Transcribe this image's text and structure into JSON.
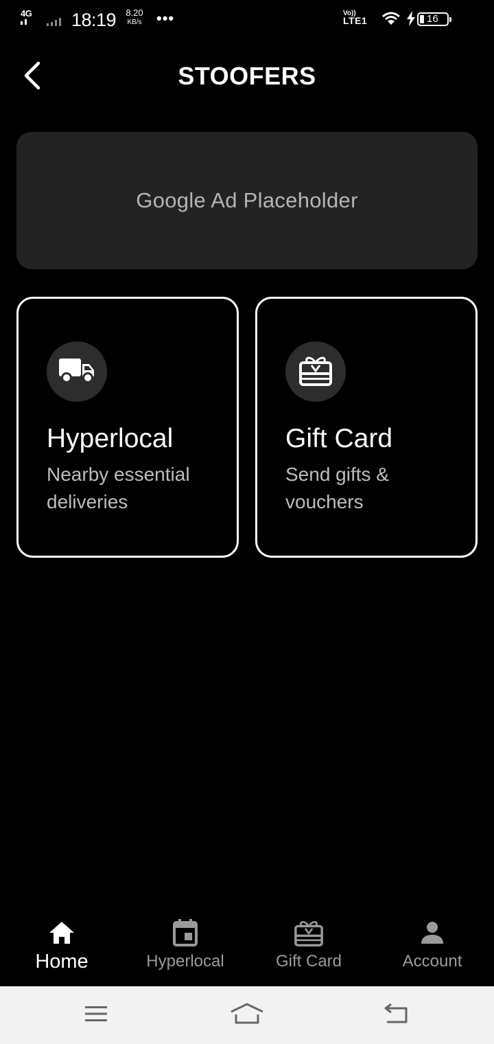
{
  "status_bar": {
    "network_type": "4G",
    "time": "18:19",
    "speed_value": "8.20",
    "speed_unit": "KB/s",
    "more": "•••",
    "volte": "Vo))",
    "lte": "LTE1",
    "battery_level": "16"
  },
  "app_bar": {
    "title": "STOOFERS",
    "back_icon": "chevron-left-icon"
  },
  "ad": {
    "text": "Google Ad Placeholder"
  },
  "cards": [
    {
      "icon": "truck-icon",
      "title": "Hyperlocal",
      "subtitle": "Nearby essential deliveries"
    },
    {
      "icon": "gift-card-icon",
      "title": "Gift Card",
      "subtitle": "Send gifts & vouchers"
    }
  ],
  "bottom_nav": [
    {
      "icon": "home-icon",
      "label": "Home",
      "active": true
    },
    {
      "icon": "calendar-icon",
      "label": "Hyperlocal",
      "active": false
    },
    {
      "icon": "gift-card-icon",
      "label": "Gift Card",
      "active": false
    },
    {
      "icon": "person-icon",
      "label": "Account",
      "active": false
    }
  ],
  "colors": {
    "background": "#000000",
    "ad_background": "#232323",
    "icon_circle": "#2d2d2d",
    "inactive_text": "#9a9a9a",
    "system_nav": "#f2f2f2"
  }
}
